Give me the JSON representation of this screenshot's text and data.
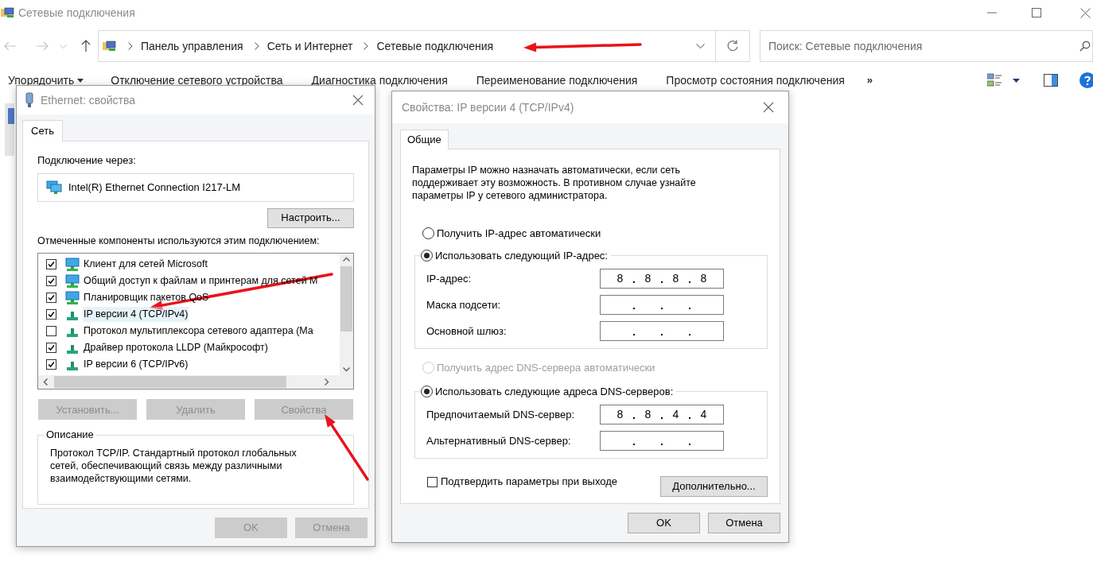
{
  "window": {
    "title": "Сетевые подключения"
  },
  "address_bar": {
    "path": [
      "Панель управления",
      "Сеть и Интернет",
      "Сетевые подключения"
    ]
  },
  "search": {
    "placeholder": "Поиск: Сетевые подключения"
  },
  "toolbar": {
    "items": [
      {
        "label": "Упорядочить",
        "kind": "menu"
      },
      {
        "label": "Отключение сетевого устройства",
        "kind": "command"
      },
      {
        "label": "Диагностика подключения",
        "kind": "command"
      },
      {
        "label": "Переименование подключения",
        "kind": "command"
      },
      {
        "label": "Просмотр состояния подключения",
        "kind": "command"
      }
    ],
    "overflow": "»"
  },
  "ethernet_dialog": {
    "title": "Ethernet: свойства",
    "tabs": [
      {
        "label": "Сеть",
        "selected": true
      }
    ],
    "connect_using_label": "Подключение через:",
    "adapter": "Intel(R) Ethernet Connection I217-LM",
    "configure_button": "Настроить...",
    "components_label": "Отмеченные компоненты используются этим подключением:",
    "components": [
      {
        "label": "Клиент для сетей Microsoft",
        "kind": "client",
        "checked": true,
        "selected": false
      },
      {
        "label": "Общий доступ к файлам и принтерам для сетей M",
        "kind": "service",
        "checked": true,
        "selected": false
      },
      {
        "label": "Планировщик пакетов QoS",
        "kind": "service",
        "checked": true,
        "selected": false
      },
      {
        "label": "IP версии 4 (TCP/IPv4)",
        "kind": "protocol",
        "checked": true,
        "selected": true
      },
      {
        "label": "Протокол мультиплексора сетевого адаптера (Ма",
        "kind": "protocol",
        "checked": false,
        "selected": false
      },
      {
        "label": "Драйвер протокола LLDP (Майкрософт)",
        "kind": "protocol",
        "checked": true,
        "selected": false
      },
      {
        "label": "IP версии 6 (TCP/IPv6)",
        "kind": "protocol",
        "checked": true,
        "selected": false
      }
    ],
    "buttons": [
      {
        "label": "Установить...",
        "disabled": true
      },
      {
        "label": "Удалить",
        "disabled": true
      },
      {
        "label": "Свойства",
        "disabled": true
      }
    ],
    "description": {
      "legend": "Описание",
      "text": "Протокол TCP/IP. Стандартный протокол глобальных сетей, обеспечивающий связь между различными взаимодействующими сетями."
    },
    "footer_buttons": [
      {
        "label": "OK",
        "disabled": true
      },
      {
        "label": "Отмена",
        "disabled": true
      }
    ]
  },
  "ipv4_dialog": {
    "title": "Свойства: IP версии 4 (TCP/IPv4)",
    "tabs": [
      {
        "label": "Общие",
        "selected": true
      }
    ],
    "intro": "Параметры IP можно назначать автоматически, если сеть поддерживает эту возможность. В противном случае узнайте параметры IP у сетевого администратора.",
    "ip_mode": [
      {
        "label": "Получить IP-адрес автоматически",
        "selected": false,
        "disabled": false
      },
      {
        "label": "Использовать следующий IP-адрес:",
        "selected": true,
        "disabled": false
      }
    ],
    "ip_fields": [
      {
        "label": "IP-адрес:",
        "octets": [
          "8",
          "8",
          "8",
          "8"
        ]
      },
      {
        "label": "Маска подсети:"
      },
      {
        "label": "Основной шлюз:"
      }
    ],
    "dns_mode": [
      {
        "label": "Получить адрес DNS-сервера автоматически",
        "selected": false,
        "disabled": true
      },
      {
        "label": "Использовать следующие адреса DNS-серверов:",
        "selected": true,
        "disabled": false
      }
    ],
    "dns_fields": [
      {
        "label": "Предпочитаемый DNS-сервер:",
        "octets": [
          "8",
          "8",
          "4",
          "4"
        ]
      },
      {
        "label": "Альтернативный DNS-сервер:"
      }
    ],
    "validate_on_exit": {
      "label": "Подтвердить параметры при выходе",
      "checked": false
    },
    "advanced_button": "Дополнительно...",
    "footer_buttons": [
      {
        "label": "OK",
        "disabled": false
      },
      {
        "label": "Отмена",
        "disabled": false
      }
    ]
  }
}
